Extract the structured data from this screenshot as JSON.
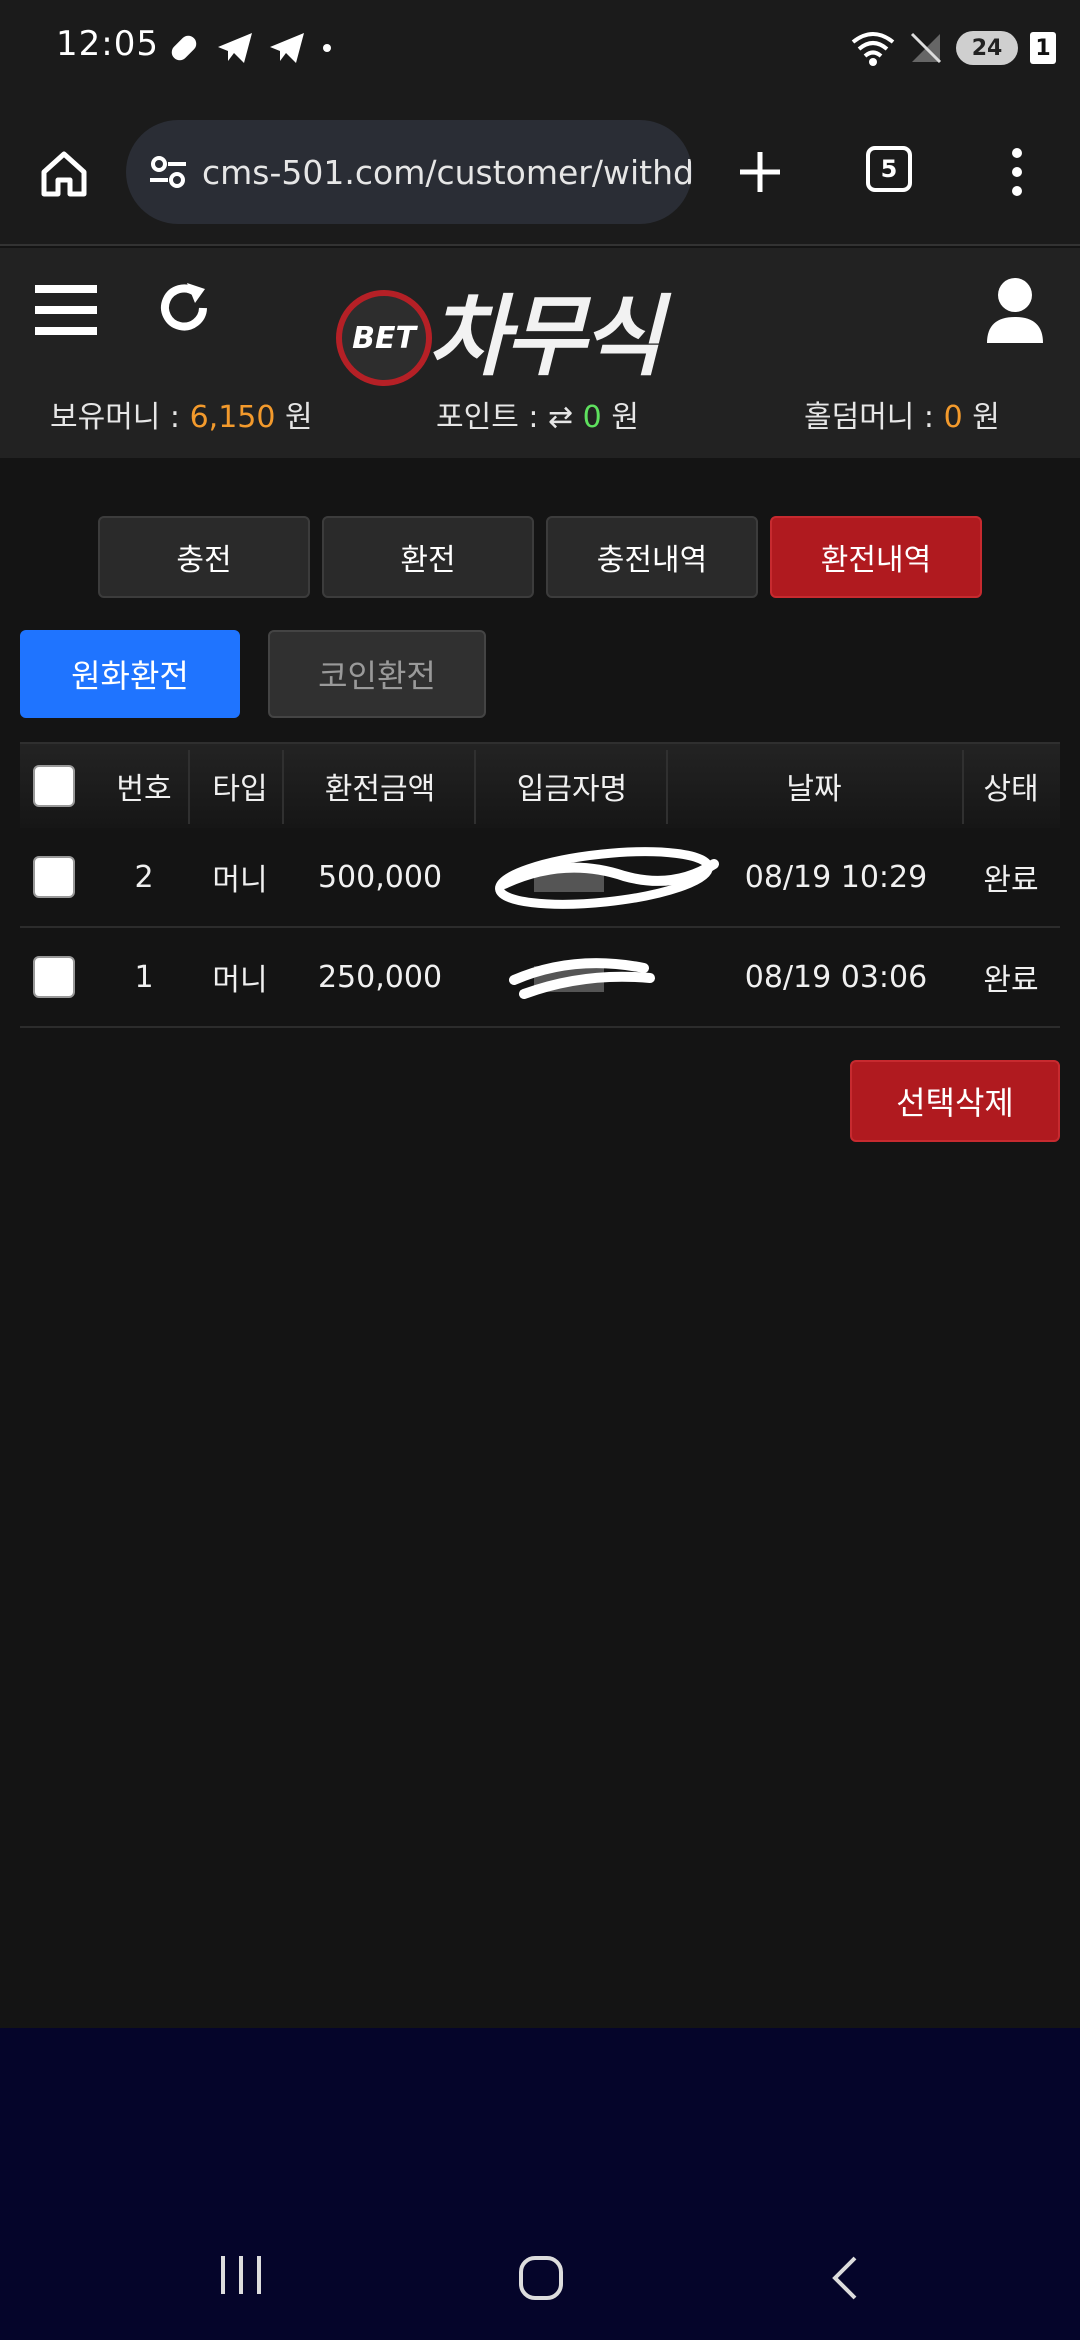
{
  "status_bar": {
    "time": "12:05",
    "battery": "24",
    "sim_slot": "1"
  },
  "browser": {
    "url": "cms-501.com/customer/withdr",
    "tab_count": "5"
  },
  "header": {
    "logo_prefix": "BET",
    "logo_text": "차무식",
    "balance_label": "보유머니 : ",
    "balance_value": "6,150",
    "point_label": "포인트 : ",
    "point_value": "0",
    "holdem_label": "홀덤머니 : ",
    "holdem_value": "0",
    "currency": "원"
  },
  "tabs": [
    {
      "label": "충전"
    },
    {
      "label": "환전"
    },
    {
      "label": "충전내역"
    },
    {
      "label": "환전내역"
    }
  ],
  "subtabs": [
    {
      "label": "원화환전"
    },
    {
      "label": "코인환전"
    }
  ],
  "table": {
    "headers": [
      "번호",
      "타입",
      "환전금액",
      "입금자명",
      "날짜",
      "상태"
    ],
    "rows": [
      {
        "no": "2",
        "type": "머니",
        "amount": "500,000",
        "date": "08/19 10:29",
        "status": "완료"
      },
      {
        "no": "1",
        "type": "머니",
        "amount": "250,000",
        "date": "08/19 03:06",
        "status": "완료"
      }
    ]
  },
  "delete_button": "선택삭제",
  "colors": {
    "accent_red": "#b01a1f",
    "accent_blue": "#1f74ff",
    "orange": "#f39a2c",
    "green": "#5ee05e"
  }
}
